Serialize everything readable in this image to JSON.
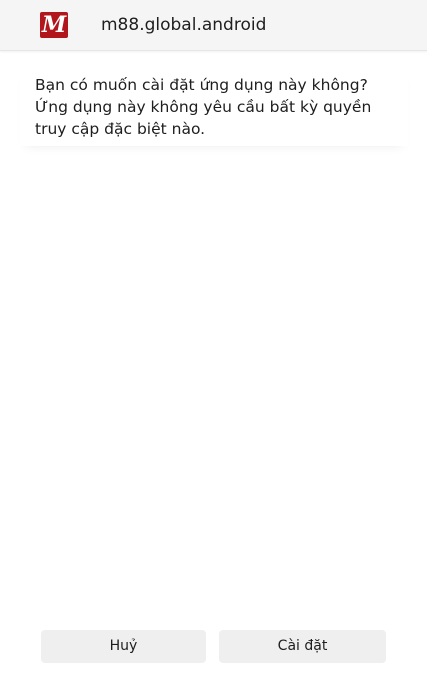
{
  "header": {
    "app_icon": {
      "name": "m88-app-icon",
      "letter": "M",
      "color": "#b0161c"
    },
    "app_name": "m88.global.android"
  },
  "message": {
    "lines": [
      "Bạn có muốn cài đặt ứng dụng này không?",
      "Ứng dụng này không yêu cầu bất kỳ quyền",
      "truy cập đặc biệt nào."
    ]
  },
  "buttons": {
    "cancel_label": "Huỷ",
    "install_label": "Cài đặt"
  }
}
